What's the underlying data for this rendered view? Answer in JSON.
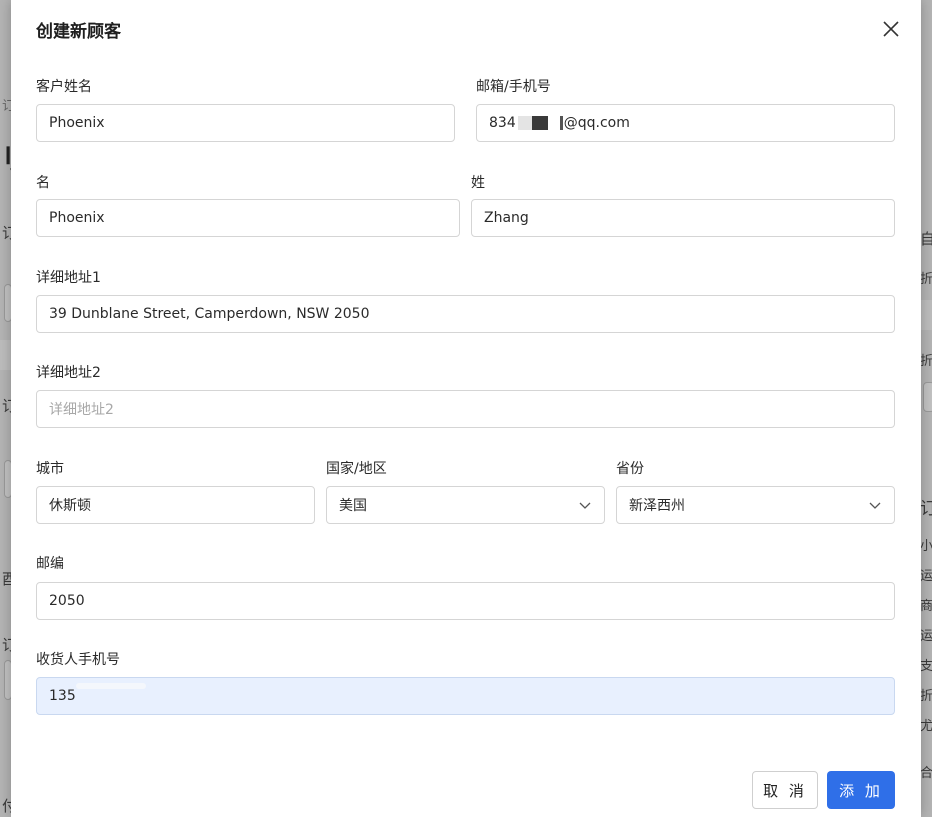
{
  "modal": {
    "title": "创建新顾客",
    "close_icon": "close-icon"
  },
  "form": {
    "customer_name": {
      "label": "客户姓名",
      "value": "Phoenix"
    },
    "email_phone": {
      "label": "邮箱/手机号",
      "value_prefix": "834",
      "value_suffix": "@qq.com"
    },
    "first_name": {
      "label": "名",
      "value": "Phoenix"
    },
    "last_name": {
      "label": "姓",
      "value": "Zhang"
    },
    "address1": {
      "label": "详细地址1",
      "value": "39 Dunblane Street, Camperdown, NSW 2050"
    },
    "address2": {
      "label": "详细地址2",
      "placeholder": "详细地址2",
      "value": ""
    },
    "city": {
      "label": "城市",
      "value": "休斯顿"
    },
    "country": {
      "label": "国家/地区",
      "value": "美国"
    },
    "province": {
      "label": "省份",
      "value": "新泽西州"
    },
    "postcode": {
      "label": "邮编",
      "value": "2050"
    },
    "receiver_phone": {
      "label": "收货人手机号",
      "value": "135"
    }
  },
  "actions": {
    "cancel_label": "取 消",
    "add_label": "添 加"
  },
  "colors": {
    "primary": "#2f6fe8",
    "active_field_bg": "#e8f0fe",
    "border": "#d5d5d5"
  }
}
